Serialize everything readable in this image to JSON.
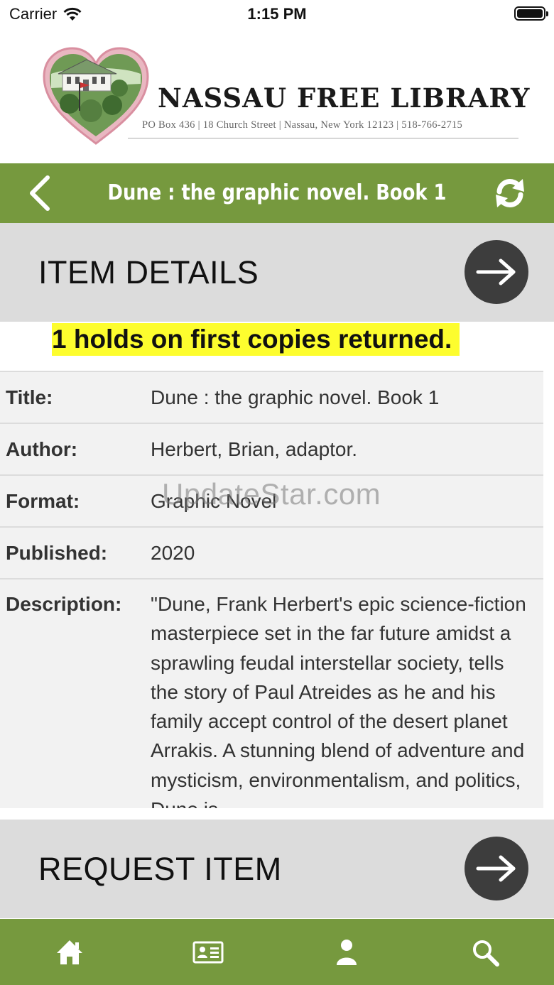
{
  "status_bar": {
    "carrier": "Carrier",
    "time": "1:15 PM"
  },
  "header": {
    "library_name": "NASSAU FREE LIBRARY",
    "address": "PO Box 436 | 18 Church Street | Nassau, New York 12123 | 518-766-2715"
  },
  "nav": {
    "title": "Dune : the graphic novel. Book 1",
    "back_icon": "chevron-left-icon",
    "refresh_icon": "refresh-icon"
  },
  "item_details_section": {
    "title": "ITEM DETAILS"
  },
  "holds_notice": "1 holds on first copies returned.",
  "details": {
    "rows": [
      {
        "label": "Title:",
        "value": "Dune : the graphic novel. Book 1"
      },
      {
        "label": "Author:",
        "value": "Herbert, Brian, adaptor."
      },
      {
        "label": "Format:",
        "value": "Graphic Novel"
      },
      {
        "label": "Published:",
        "value": "2020"
      },
      {
        "label": "Description:",
        "value": "\"Dune, Frank Herbert's epic science-fiction masterpiece set in the far future amidst a sprawling feudal interstellar society, tells the story of Paul Atreides as he and his family accept control of the desert planet Arrakis. A stunning blend of adventure and mysticism, environmentalism, and politics, Dune is"
      }
    ]
  },
  "watermark": "UpdateStar.com",
  "request_section": {
    "title": "REQUEST ITEM"
  },
  "tab_bar": {
    "tabs": [
      {
        "icon": "home-icon"
      },
      {
        "icon": "library-card-icon"
      },
      {
        "icon": "account-icon"
      },
      {
        "icon": "search-icon"
      }
    ]
  },
  "colors": {
    "brand_green": "#76993e",
    "highlight_yellow": "#fdfd2e",
    "section_gray": "#dcdcdc",
    "arrow_button": "#3d3d3d"
  }
}
